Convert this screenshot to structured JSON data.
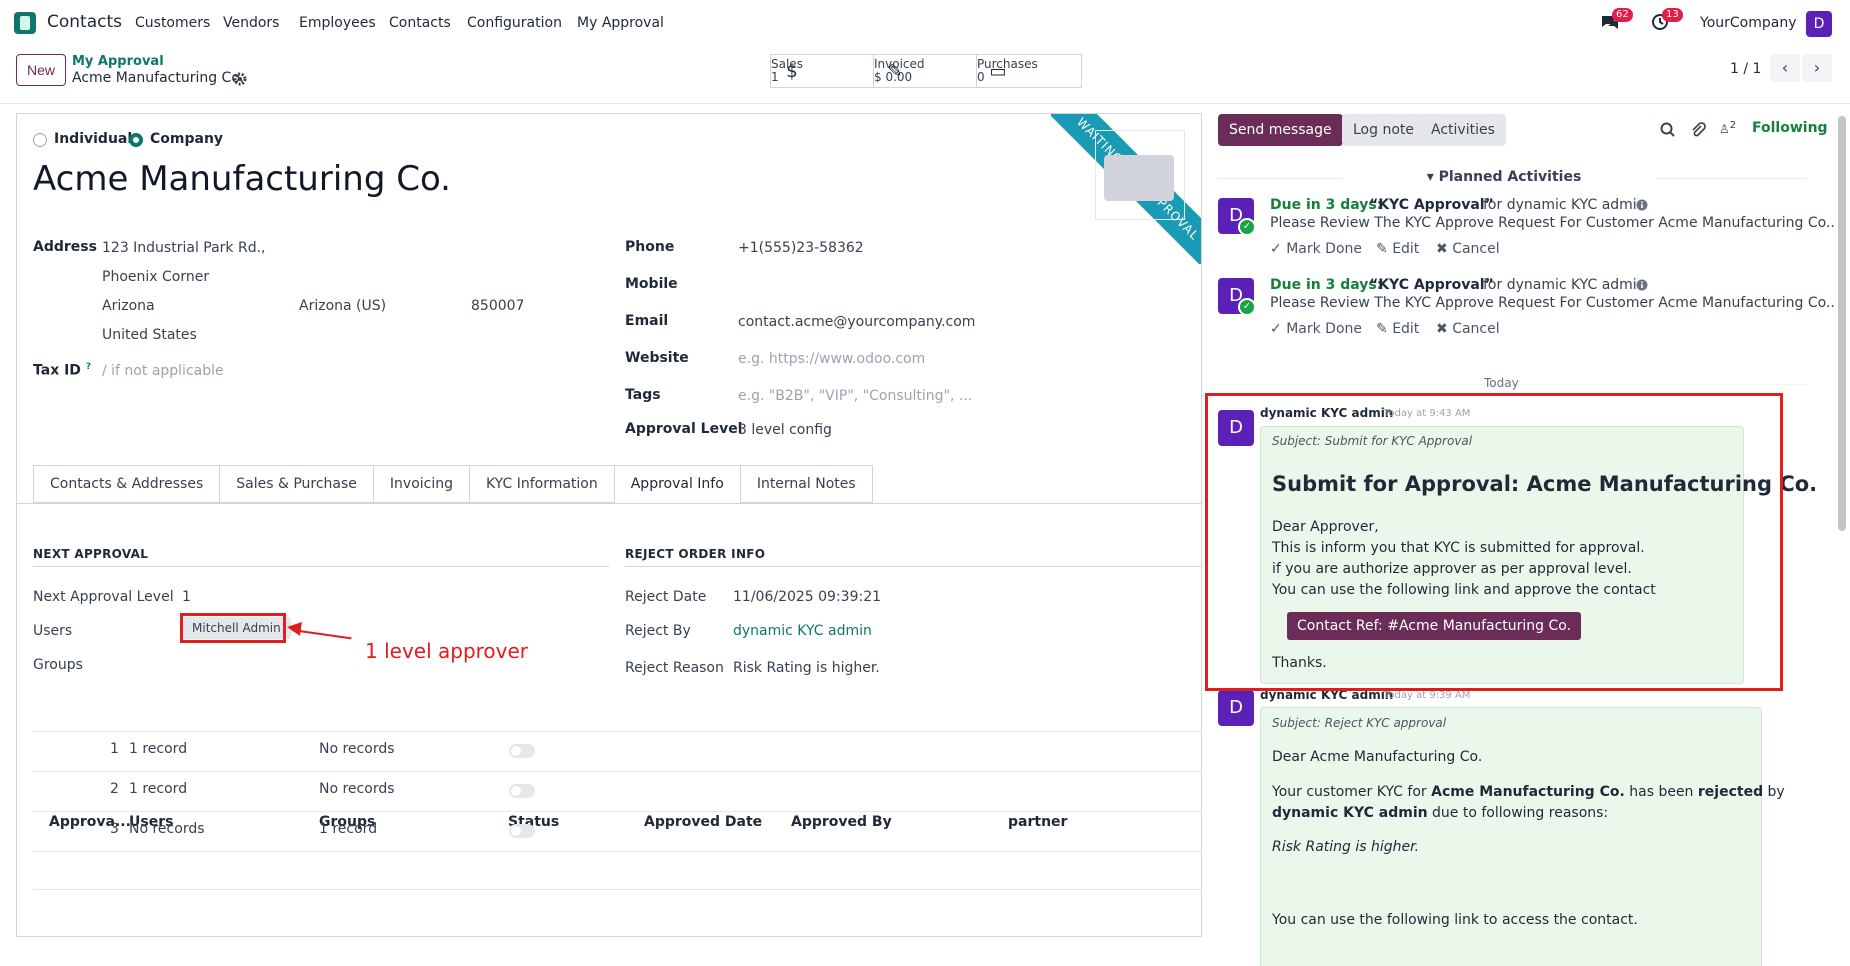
{
  "topbar": {
    "app_name": "Contacts",
    "menu": [
      "Customers",
      "Vendors",
      "Employees",
      "Contacts",
      "Configuration",
      "My Approval"
    ],
    "messages_count": "62",
    "activities_count": "13",
    "company": "YourCompany",
    "user_initial": "D"
  },
  "control": {
    "new_label": "New",
    "breadcrumb_parent": "My Approval",
    "breadcrumb_current": "Acme Manufacturing Co.",
    "smart_buttons": [
      {
        "label": "Sales",
        "value": "1",
        "icon": "dollar-icon"
      },
      {
        "label": "Invoiced",
        "value": "$ 0.00",
        "icon": "pencil-square-icon"
      },
      {
        "label": "Purchases",
        "value": "0",
        "icon": "credit-card-icon"
      }
    ],
    "pager": "1 / 1"
  },
  "form": {
    "type_individual": "Individual",
    "type_company": "Company",
    "name": "Acme Manufacturing Co.",
    "ribbon": "WAITING FOR APPROVAL",
    "address_label": "Address",
    "street": "123 Industrial Park Rd.,",
    "street2": "Phoenix Corner",
    "city": "Arizona",
    "state": "Arizona (US)",
    "zip": "850007",
    "country": "United States",
    "taxid_label": "Tax ID",
    "taxid_sup": "?",
    "taxid_placeholder": "/ if not applicable",
    "phone_label": "Phone",
    "phone": "+1(555)23-58362",
    "mobile_label": "Mobile",
    "email_label": "Email",
    "email": "contact.acme@yourcompany.com",
    "website_label": "Website",
    "website_placeholder": "e.g. https://www.odoo.com",
    "tags_label": "Tags",
    "tags_placeholder": "e.g. \"B2B\", \"VIP\", \"Consulting\", ...",
    "approval_level_label": "Approval Level",
    "approval_level": "3 level config"
  },
  "tabs": [
    "Contacts & Addresses",
    "Sales & Purchase",
    "Invoicing",
    "KYC Information",
    "Approval Info",
    "Internal Notes"
  ],
  "approval_info": {
    "next_approval_title": "NEXT APPROVAL",
    "next_level_label": "Next Approval Level",
    "next_level": "1",
    "users_label": "Users",
    "user_tag": "Mitchell Admin",
    "groups_label": "Groups",
    "annotation": "1 level approver",
    "reject_title": "REJECT ORDER INFO",
    "reject_date_label": "Reject Date",
    "reject_date": "11/06/2025 09:39:21",
    "reject_by_label": "Reject By",
    "reject_by": "dynamic KYC admin",
    "reject_reason_label": "Reject Reason",
    "reject_reason": "Risk Rating is higher.",
    "table_headers": [
      "Approva...",
      "Users",
      "Groups",
      "Status",
      "Approved Date",
      "Approved By",
      "partner"
    ],
    "rows": [
      {
        "level": "1",
        "users": "1 record",
        "groups": "No records"
      },
      {
        "level": "2",
        "users": "1 record",
        "groups": "No records"
      },
      {
        "level": "3",
        "users": "No records",
        "groups": "1 record"
      }
    ]
  },
  "chatter": {
    "send_message": "Send message",
    "log_note": "Log note",
    "activities": "Activities",
    "followers_count": "2",
    "following": "Following",
    "planned_title": "Planned Activities",
    "activities_list": [
      {
        "due": "Due in 3 days:",
        "name": "“KYC Approval”",
        "for": "for dynamic KYC admin",
        "desc": "Please Review The KYC Approve Request For Customer Acme Manufacturing Co..",
        "mark_done": "Mark Done",
        "edit": "Edit",
        "cancel": "Cancel"
      },
      {
        "due": "Due in 3 days:",
        "name": "“KYC Approval”",
        "for": "for dynamic KYC admin",
        "desc": "Please Review The KYC Approve Request For Customer Acme Manufacturing Co..",
        "mark_done": "Mark Done",
        "edit": "Edit",
        "cancel": "Cancel"
      }
    ],
    "today": "Today",
    "message1": {
      "author": "dynamic KYC admin",
      "time": "Today at 9:43 AM",
      "subject": "Subject: Submit for KYC Approval",
      "heading": "Submit for Approval: Acme Manufacturing Co.",
      "line1": "Dear Approver,",
      "line2": "This is inform you that KYC is submitted for approval.",
      "line3": "if you are authorize approver as per approval level.",
      "line4": "You can use the following link and approve the contact",
      "button": "Contact Ref: #Acme Manufacturing Co.",
      "thanks": "Thanks."
    },
    "message2": {
      "author": "dynamic KYC admin",
      "time": "Today at 9:39 AM",
      "subject": "Subject: Reject KYC approval",
      "line1": "Dear Acme Manufacturing Co.",
      "line2a": "Your customer KYC for ",
      "line2b": "Acme Manufacturing Co.",
      "line2c": " has been ",
      "line2d": "rejected",
      "line2e": " by",
      "line3a": "dynamic KYC admin",
      "line3b": " due to following reasons:",
      "reason": "Risk Rating is higher.",
      "line4": "You can use the following link to access the contact."
    }
  }
}
